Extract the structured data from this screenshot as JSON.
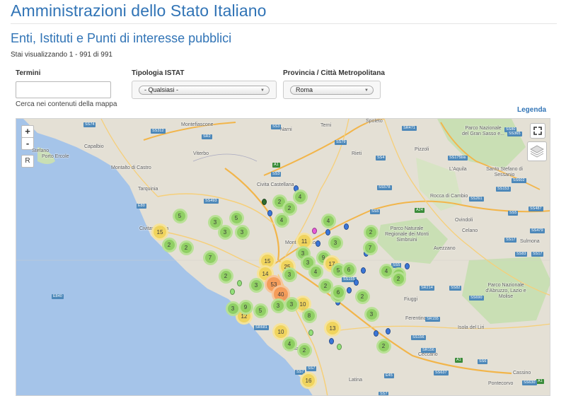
{
  "header": {
    "title": "Amministrazioni dello Stato Italiano",
    "section_title": "Enti, Istituti e Punti di interesse pubblici",
    "results": "Stai visualizzando 1 - 991 di 991"
  },
  "filters": {
    "terms_label": "Termini",
    "terms_value": "",
    "terms_help": "Cerca nei contenuti della mappa",
    "type_label": "Tipologia ISTAT",
    "type_value": "- Qualsiasi -",
    "province_label": "Provincia / Città Metropolitana",
    "province_value": "Roma"
  },
  "legend_label": "Legenda",
  "map": {
    "zoom_in": "+",
    "zoom_out": "-",
    "reset": "R",
    "places": [
      {
        "id": "montefiascone",
        "name": "Montefiascone"
      },
      {
        "id": "narni",
        "name": "Narni"
      },
      {
        "id": "terni",
        "name": "Terni"
      },
      {
        "id": "spoleto",
        "name": "Spoleto"
      },
      {
        "id": "parco-gran-sasso",
        "name": "Parco Nazionale del Gran Sasso e..."
      },
      {
        "id": "stefano",
        "name": "Stefano"
      },
      {
        "id": "porto-ercole",
        "name": "Porto Ercole"
      },
      {
        "id": "capalbio",
        "name": "Capalbio"
      },
      {
        "id": "viterbo",
        "name": "Viterbo"
      },
      {
        "id": "montalto",
        "name": "Montalto di Castro"
      },
      {
        "id": "tarquinia",
        "name": "Tarquinia"
      },
      {
        "id": "civita-castellana",
        "name": "Civita Castellana"
      },
      {
        "id": "rieti",
        "name": "Rieti"
      },
      {
        "id": "pizzoli",
        "name": "Pizzoli"
      },
      {
        "id": "laquila",
        "name": "L'Aquila"
      },
      {
        "id": "santo-stefano",
        "name": "Santo Stefano di Sessanio"
      },
      {
        "id": "rocca",
        "name": "Rocca di Cambio"
      },
      {
        "id": "ovindoli",
        "name": "Ovindoli"
      },
      {
        "id": "celano",
        "name": "Celano"
      },
      {
        "id": "sulmona",
        "name": "Sulmona"
      },
      {
        "id": "civitavecchia",
        "name": "Civitavecchia"
      },
      {
        "id": "monterotondo",
        "name": "Monterotondo"
      },
      {
        "id": "parco-simbruini",
        "name": "Parco Naturale Regionale dei Monti Simbruini"
      },
      {
        "id": "avezzano",
        "name": "Avezzano"
      },
      {
        "id": "parco-abruzzo",
        "name": "Parco Nazionale d'Abruzzo, Lazio e Molise"
      },
      {
        "id": "fiuggi",
        "name": "Fiuggi"
      },
      {
        "id": "ferentino",
        "name": "Ferentino"
      },
      {
        "id": "isola-liri",
        "name": "Isola del Liri"
      },
      {
        "id": "aprilia",
        "name": "Aprilia"
      },
      {
        "id": "ceccano",
        "name": "Ceccano"
      },
      {
        "id": "latina",
        "name": "Latina"
      },
      {
        "id": "cassino",
        "name": "Cassino"
      },
      {
        "id": "pontecorvo",
        "name": "Pontecorvo"
      }
    ],
    "roads": [
      {
        "id": "r1",
        "label": "SS74"
      },
      {
        "id": "r2",
        "label": "SS312"
      },
      {
        "id": "r3",
        "label": "SR2"
      },
      {
        "id": "r4",
        "label": "SS3"
      },
      {
        "id": "r5",
        "label": "SS79"
      },
      {
        "id": "r6",
        "label": "SS4"
      },
      {
        "id": "r7",
        "label": "SR471"
      },
      {
        "id": "r8",
        "label": "SS80"
      },
      {
        "id": "r9",
        "label": "SS365"
      },
      {
        "id": "r10",
        "label": "SS175bis"
      },
      {
        "id": "r11",
        "label": "A1"
      },
      {
        "id": "r12",
        "label": "SS3"
      },
      {
        "id": "r13",
        "label": "SS578"
      },
      {
        "id": "r14",
        "label": "SS493"
      },
      {
        "id": "r15",
        "label": "SS602"
      },
      {
        "id": "r16",
        "label": "SS153"
      },
      {
        "id": "r17",
        "label": "SS261"
      },
      {
        "id": "r18",
        "label": "E80"
      },
      {
        "id": "r19",
        "label": "A24"
      },
      {
        "id": "r20",
        "label": "SS5"
      },
      {
        "id": "r21",
        "label": "SS487"
      },
      {
        "id": "r22",
        "label": "SS5"
      },
      {
        "id": "r23",
        "label": "SS17"
      },
      {
        "id": "r24",
        "label": "SS479"
      },
      {
        "id": "r25",
        "label": "SS83"
      },
      {
        "id": "r26",
        "label": "E840"
      },
      {
        "id": "r27",
        "label": "SS155"
      },
      {
        "id": "r28",
        "label": "SR214"
      },
      {
        "id": "r29",
        "label": "SS690"
      },
      {
        "id": "r30",
        "label": "SR681"
      },
      {
        "id": "r31",
        "label": "SR155"
      },
      {
        "id": "r32",
        "label": "SS156"
      },
      {
        "id": "r33",
        "label": "SR156"
      },
      {
        "id": "r34",
        "label": "SS637"
      },
      {
        "id": "r35",
        "label": "SS7"
      },
      {
        "id": "r36",
        "label": "E45"
      },
      {
        "id": "r37",
        "label": "A1"
      },
      {
        "id": "r38",
        "label": "SS6"
      },
      {
        "id": "r39",
        "label": "A1"
      },
      {
        "id": "r40",
        "label": "SS7"
      },
      {
        "id": "r41",
        "label": "SS7"
      },
      {
        "id": "r42",
        "label": "SS17"
      },
      {
        "id": "r43",
        "label": "SS82"
      },
      {
        "id": "r44",
        "label": "SS630"
      },
      {
        "id": "r45",
        "label": "SS5"
      }
    ],
    "clusters": [
      {
        "id": "c1",
        "count": "2"
      },
      {
        "id": "c2",
        "count": "4"
      },
      {
        "id": "c3",
        "count": "2"
      },
      {
        "id": "c4",
        "count": "5"
      },
      {
        "id": "c5",
        "count": "3"
      },
      {
        "id": "c6",
        "count": "3"
      },
      {
        "id": "c7",
        "count": "5"
      },
      {
        "id": "c8",
        "count": "4"
      },
      {
        "id": "c9",
        "count": "3"
      },
      {
        "id": "c10",
        "count": "15"
      },
      {
        "id": "c11",
        "count": "2"
      },
      {
        "id": "c12",
        "count": "2"
      },
      {
        "id": "c13",
        "count": "11"
      },
      {
        "id": "c14",
        "count": "3"
      },
      {
        "id": "c15",
        "count": "4"
      },
      {
        "id": "c16",
        "count": "3"
      },
      {
        "id": "c17",
        "count": "2"
      },
      {
        "id": "c18",
        "count": "7"
      },
      {
        "id": "c19",
        "count": "15"
      },
      {
        "id": "c20",
        "count": "3"
      },
      {
        "id": "c21",
        "count": "9"
      },
      {
        "id": "c22",
        "count": "17"
      },
      {
        "id": "c23",
        "count": "14"
      },
      {
        "id": "c24",
        "count": "25"
      },
      {
        "id": "c25",
        "count": "7"
      },
      {
        "id": "c26",
        "count": "3"
      },
      {
        "id": "c27",
        "count": "4"
      },
      {
        "id": "c28",
        "count": "4"
      },
      {
        "id": "c29",
        "count": "53"
      },
      {
        "id": "c30",
        "count": "5"
      },
      {
        "id": "c31",
        "count": "6"
      },
      {
        "id": "c32",
        "count": "2"
      },
      {
        "id": "c33",
        "count": "40"
      },
      {
        "id": "c34",
        "count": "2"
      },
      {
        "id": "c35",
        "count": "7"
      },
      {
        "id": "c36",
        "count": "3"
      },
      {
        "id": "c37",
        "count": "12"
      },
      {
        "id": "c38",
        "count": "9"
      },
      {
        "id": "c39",
        "count": "10"
      },
      {
        "id": "c40",
        "count": "8"
      },
      {
        "id": "c41",
        "count": "3"
      },
      {
        "id": "c42",
        "count": "5"
      },
      {
        "id": "c43",
        "count": "13"
      },
      {
        "id": "c44",
        "count": "10"
      },
      {
        "id": "c45",
        "count": "4"
      },
      {
        "id": "c46",
        "count": "2"
      },
      {
        "id": "c47",
        "count": "2"
      },
      {
        "id": "c48",
        "count": "3"
      },
      {
        "id": "c49",
        "count": "16"
      },
      {
        "id": "c50",
        "count": "6"
      },
      {
        "id": "c51",
        "count": "3"
      },
      {
        "id": "c52",
        "count": "2"
      },
      {
        "id": "c53",
        "count": "3"
      },
      {
        "id": "c54",
        "count": "2"
      },
      {
        "id": "c55",
        "count": "3"
      }
    ],
    "colors": {
      "cluster_small": "#8ccf5e",
      "cluster_small_halo": "#b7e293",
      "cluster_medium": "#f1d458",
      "cluster_medium_halo": "#f7e498",
      "cluster_large": "#f59a55",
      "cluster_large_halo": "#f8c59a",
      "poi_blue": "#3b76d8",
      "poi_green": "#93e07a",
      "poi_pink": "#e65ad8",
      "poi_dark": "#2e6b2e",
      "sea": "#a5c4e9",
      "land": "#e4e0d5",
      "park": "#c9dfb4"
    }
  }
}
